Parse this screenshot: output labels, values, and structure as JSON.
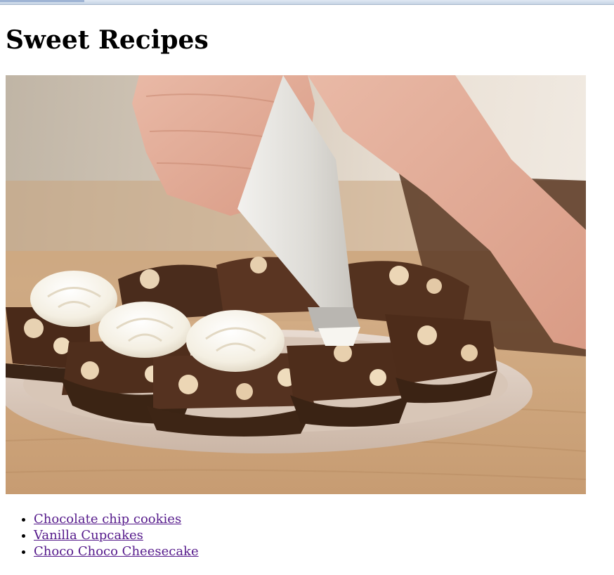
{
  "page": {
    "heading": "Sweet Recipes"
  },
  "hero_image": {
    "subject": "hands piping whipped cream onto brownie cupcakes on a plate",
    "icons": [
      "piping-bag-icon",
      "hand-icon",
      "plate-icon",
      "cupcake-icon",
      "cream-swirl-icon"
    ]
  },
  "recipes": [
    {
      "label": "Chocolate chip cookies"
    },
    {
      "label": "Vanilla Cupcakes"
    },
    {
      "label": "Choco Choco Cheesecake"
    }
  ],
  "colors": {
    "link_visited": "#551a8b",
    "heading": "#000000",
    "background": "#ffffff"
  }
}
